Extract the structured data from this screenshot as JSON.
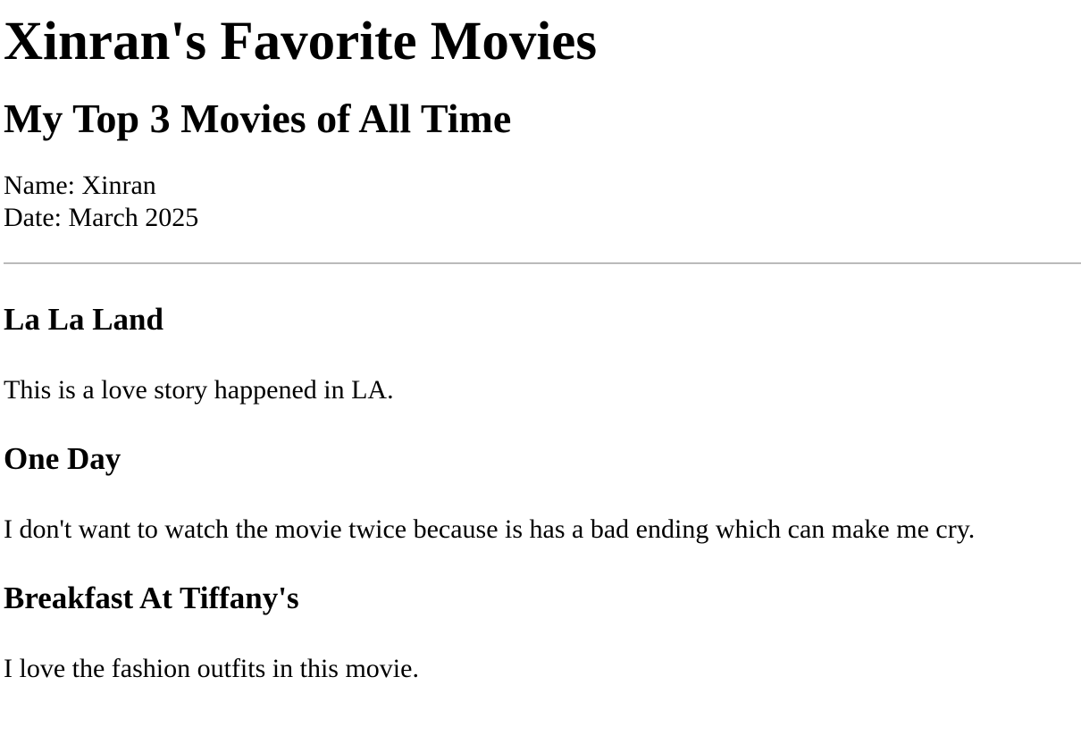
{
  "page": {
    "title": "Xinran's Favorite Movies",
    "subtitle": "My Top 3 Movies of All Time",
    "name_line": "Name: Xinran",
    "date_line": "Date: March 2025"
  },
  "movies": [
    {
      "title": "La La Land",
      "description": "This is a love story happened in LA."
    },
    {
      "title": "One Day",
      "description": "I don't want to watch the movie twice because is has a bad ending which can make me cry."
    },
    {
      "title": "Breakfast At Tiffany's",
      "description": "I love the fashion outfits in this movie."
    }
  ]
}
